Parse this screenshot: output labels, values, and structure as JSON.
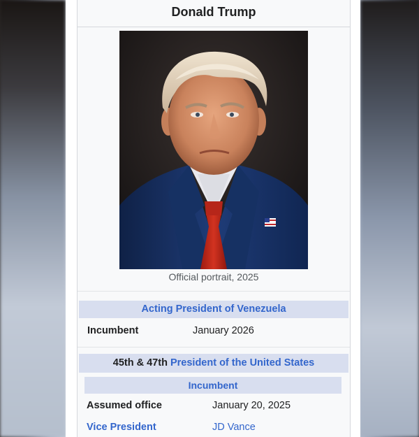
{
  "infobox": {
    "title": "Donald Trump",
    "portrait_caption": "Official portrait, 2025",
    "section1": {
      "heading": "Acting President of Venezuela",
      "row_label": "Incumbent",
      "row_value": "January 2026"
    },
    "section2": {
      "heading_prefix": "45th & 47th",
      "heading_link": "President of the United States",
      "status": "Incumbent",
      "assumed_label": "Assumed office",
      "assumed_value": "January 20, 2025",
      "vp_label": "Vice President",
      "vp_value": "JD Vance"
    }
  },
  "colors": {
    "link": "#3366cc",
    "header_band": "#d8deef",
    "infobox_bg": "#f8f9fa"
  }
}
